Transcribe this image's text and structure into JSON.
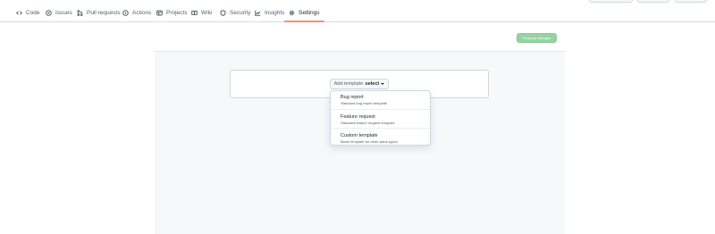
{
  "nav": {
    "tabs": [
      {
        "id": "code",
        "label": "Code",
        "icon": "code-icon"
      },
      {
        "id": "issues",
        "label": "Issues",
        "icon": "issue-icon"
      },
      {
        "id": "pulls",
        "label": "Pull requests",
        "icon": "pull-request-icon"
      },
      {
        "id": "actions",
        "label": "Actions",
        "icon": "play-icon"
      },
      {
        "id": "projects",
        "label": "Projects",
        "icon": "table-icon"
      },
      {
        "id": "wiki",
        "label": "Wiki",
        "icon": "book-icon"
      },
      {
        "id": "security",
        "label": "Security",
        "icon": "shield-icon"
      },
      {
        "id": "insights",
        "label": "Insights",
        "icon": "graph-icon"
      },
      {
        "id": "settings",
        "label": "Settings",
        "icon": "gear-icon",
        "active": true
      }
    ],
    "active_underline_color": "#fd8c73"
  },
  "actions": {
    "propose_label": "Propose changes",
    "propose_color": "#94d3a2"
  },
  "template_picker": {
    "prefix": "Add template:",
    "selected": "select",
    "options": [
      {
        "title": "Bug report",
        "desc": "Standard bug report template"
      },
      {
        "title": "Feature request",
        "desc": "Standard feature request template"
      },
      {
        "title": "Custom template",
        "desc": "Blank template for other issue types"
      }
    ]
  }
}
